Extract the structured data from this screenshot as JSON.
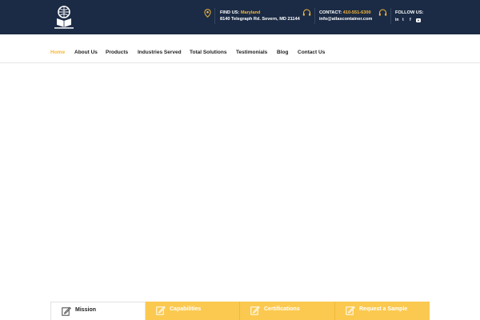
{
  "header": {
    "find_us_label": "FIND US:",
    "find_us_value": "Maryland",
    "address": "8140 Telegraph Rd. Severn, MD 21144",
    "contact_label": "CONTACT:",
    "contact_phone": "410-551-6300",
    "contact_email": "info@atlascontainer.com",
    "follow_label": "FOLLOW US:",
    "social_icons": [
      "linkedin-icon",
      "twitter-icon",
      "facebook-icon",
      "youtube-icon"
    ],
    "logo_icon": "atlas-logo-icon"
  },
  "nav": {
    "items": [
      {
        "label": "Home"
      },
      {
        "label": "About Us"
      },
      {
        "label": "Products"
      },
      {
        "label": "Industries Served"
      },
      {
        "label": "Total Solutions"
      },
      {
        "label": "Testimonials"
      },
      {
        "label": "Blog"
      },
      {
        "label": "Contact Us"
      }
    ],
    "active_index": 0
  },
  "tabs": {
    "items": [
      {
        "label": "Mission",
        "icon": "edit-icon"
      },
      {
        "label": "Capabilities",
        "icon": "edit-icon"
      },
      {
        "label": "Certifications",
        "icon": "edit-icon"
      },
      {
        "label": "Request a Sample",
        "icon": "edit-icon"
      }
    ],
    "active_index": 0
  },
  "colors": {
    "header_bg": "#1b2b45",
    "accent": "#f6b73c",
    "tab_bg": "#fbc94f",
    "text_dark": "#222222"
  }
}
